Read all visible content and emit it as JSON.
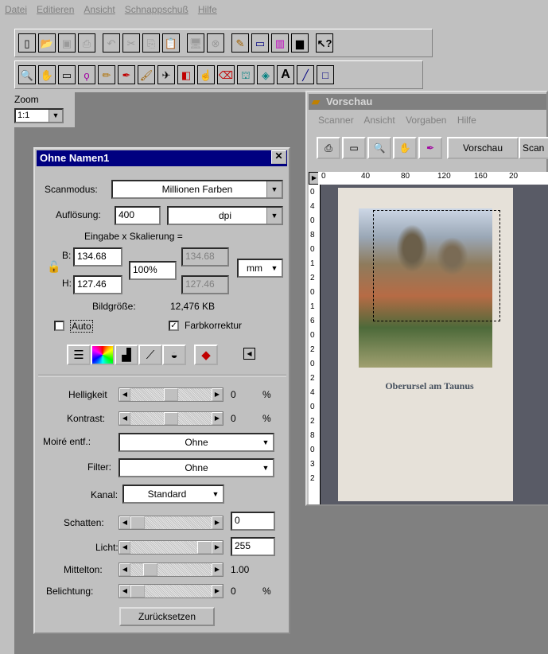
{
  "menubar": [
    "Datei",
    "Editieren",
    "Ansicht",
    "Schnappschuß",
    "Hilfe"
  ],
  "zoom": {
    "label": "Zoom",
    "value": "1:1"
  },
  "dialog": {
    "title": "Ohne Namen1",
    "scanmodus_label": "Scanmodus:",
    "scanmodus_value": "Millionen Farben",
    "aufloesung_label": "Auflösung:",
    "aufloesung_value": "400",
    "aufloesung_unit": "dpi",
    "eingabe_label": "Eingabe x Skalierung =",
    "b_label": "B:",
    "b_value": "134.68",
    "h_label": "H:",
    "h_value": "127.46",
    "scale_value": "100%",
    "b_out": "134.68",
    "h_out": "127.46",
    "unit": "mm",
    "bildgroesse_label": "Bildgröße:",
    "bildgroesse_value": "12,476 KB",
    "auto_label": "Auto",
    "farbkorrektur_label": "Farbkorrektur",
    "helligkeit_label": "Helligkeit",
    "helligkeit_value": "0",
    "kontrast_label": "Kontrast:",
    "kontrast_value": "0",
    "percent": "%",
    "moire_label": "Moiré entf.:",
    "moire_value": "Ohne",
    "filter_label": "Filter:",
    "filter_value": "Ohne",
    "kanal_label": "Kanal:",
    "kanal_value": "Standard",
    "schatten_label": "Schatten:",
    "schatten_value": "0",
    "licht_label": "Licht:",
    "licht_value": "255",
    "mittelton_label": "Mittelton:",
    "mittelton_value": "1.00",
    "belichtung_label": "Belichtung:",
    "belichtung_value": "0",
    "reset_label": "Zurücksetzen"
  },
  "vorschau": {
    "title": "Vorschau",
    "menu": [
      "Scanner",
      "Ansicht",
      "Vorgaben",
      "Hilfe"
    ],
    "vorschau_btn": "Vorschau",
    "scan_btn": "Scan",
    "ruler_h": [
      "0",
      "40",
      "80",
      "120",
      "160",
      "20"
    ],
    "ruler_v": [
      "0",
      "4",
      "0",
      "8",
      "0",
      "1",
      "2",
      "0",
      "1",
      "6",
      "0",
      "2",
      "0",
      "2",
      "4",
      "0",
      "2",
      "8",
      "0",
      "3",
      "2"
    ],
    "picture_caption": "Oberursel am Taunus"
  }
}
